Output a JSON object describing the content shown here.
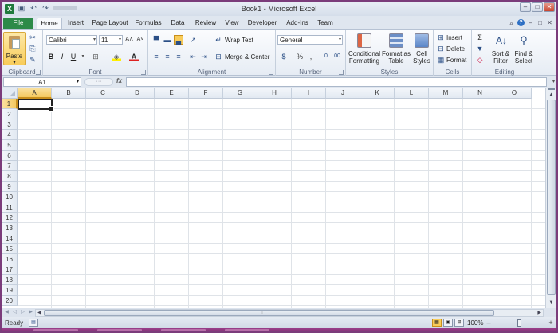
{
  "window": {
    "title": "Book1 - Microsoft Excel",
    "app_icon": "X",
    "controls": [
      "minimize",
      "restore",
      "close"
    ]
  },
  "ribbon_tabs": [
    {
      "label": "File",
      "type": "file"
    },
    {
      "label": "Home",
      "active": true
    },
    {
      "label": "Insert"
    },
    {
      "label": "Page Layout"
    },
    {
      "label": "Formulas"
    },
    {
      "label": "Data"
    },
    {
      "label": "Review"
    },
    {
      "label": "View"
    },
    {
      "label": "Developer"
    },
    {
      "label": "Add-Ins"
    },
    {
      "label": "Team"
    }
  ],
  "groups": {
    "clipboard": {
      "label": "Clipboard",
      "paste_label": "Paste"
    },
    "font": {
      "label": "Font",
      "font_name": "Calibri",
      "font_size": "11"
    },
    "alignment": {
      "label": "Alignment",
      "wrap_text": "Wrap Text",
      "merge_center": "Merge & Center"
    },
    "number": {
      "label": "Number",
      "format": "General"
    },
    "styles": {
      "label": "Styles",
      "conditional_1": "Conditional",
      "conditional_2": "Formatting",
      "format_table_1": "Format as",
      "format_table_2": "Table",
      "cell_styles_1": "Cell",
      "cell_styles_2": "Styles"
    },
    "cells": {
      "label": "Cells",
      "insert": "Insert",
      "delete": "Delete",
      "format": "Format"
    },
    "editing": {
      "label": "Editing",
      "sort_1": "Sort &",
      "sort_2": "Filter",
      "find_1": "Find &",
      "find_2": "Select"
    }
  },
  "formula_bar": {
    "name_box": "A1",
    "fx": "fx",
    "content": ""
  },
  "grid": {
    "columns": [
      "A",
      "B",
      "C",
      "D",
      "E",
      "F",
      "G",
      "H",
      "I",
      "J",
      "K",
      "L",
      "M",
      "N",
      "O"
    ],
    "rows": [
      "1",
      "2",
      "3",
      "4",
      "5",
      "6",
      "7",
      "8",
      "9",
      "10",
      "11",
      "12",
      "13",
      "14",
      "15",
      "16",
      "17",
      "18",
      "19",
      "20"
    ],
    "active_cell": "A1"
  },
  "status_bar": {
    "ready": "Ready",
    "zoom": "100%"
  },
  "colors": {
    "file_tab": "#2c8a48",
    "selection": "#f4c95f",
    "frame": "#7b3c7b"
  }
}
